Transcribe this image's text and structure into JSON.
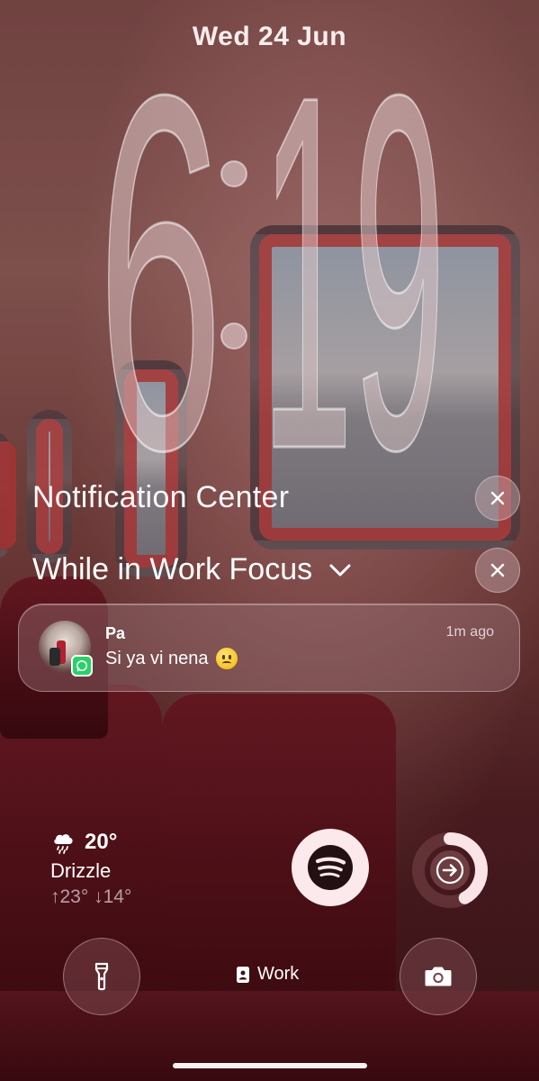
{
  "lock_screen": {
    "date": "Wed 24 Jun",
    "time_hours": "6",
    "time_minutes": "19"
  },
  "notification_center": {
    "title": "Notification Center",
    "focus_label": "While in Work Focus"
  },
  "notification": {
    "sender": "Pa",
    "message": "Si ya vi nena",
    "time": "1m ago",
    "app_icon": "whatsapp-icon"
  },
  "weather": {
    "temperature": "20°",
    "condition": "Drizzle",
    "high": "↑23°",
    "low": "↓14°",
    "icon": "cloud-drizzle-icon"
  },
  "widgets": {
    "spotify_icon": "spotify-icon",
    "activity_icon": "arrow-right-icon",
    "activity_progress": 0.42
  },
  "bottom_bar": {
    "focus_label": "Work",
    "left_icon": "flashlight-icon",
    "right_icon": "camera-icon"
  },
  "colors": {
    "spotify_bg": "#fce9ec",
    "whatsapp": "#25d366"
  }
}
